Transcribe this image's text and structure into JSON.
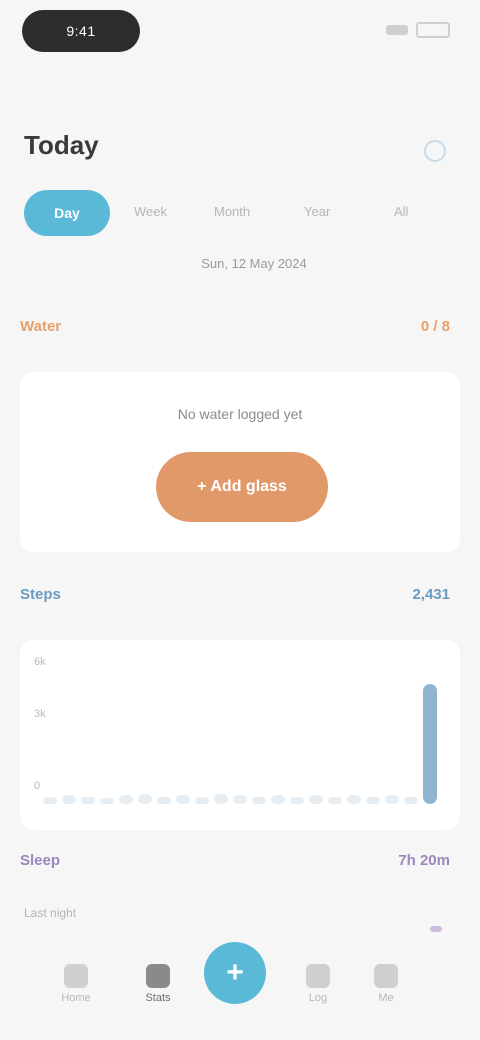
{
  "status": {
    "time": "9:41"
  },
  "header": {
    "title": "Today"
  },
  "filters": {
    "active": "Day",
    "items": [
      "Week",
      "Month",
      "Year",
      "All"
    ],
    "subtitle": "Sun, 12 May 2024"
  },
  "water": {
    "label": "Water",
    "value": "0 / 8",
    "note": "No water logged yet",
    "button_label": "+ Add glass",
    "accent": "#e2996a"
  },
  "steps": {
    "label": "Steps",
    "value": "2,431",
    "axis": [
      "6k",
      "3k",
      "0"
    ],
    "accent": "#6a9cc0",
    "bars": [
      0.05,
      0.06,
      0.05,
      0.04,
      0.06,
      0.07,
      0.05,
      0.06,
      0.05,
      0.07,
      0.06,
      0.05,
      0.06,
      0.05,
      0.06,
      0.05,
      0.06,
      0.05,
      0.06,
      0.05,
      0.8
    ]
  },
  "sleep": {
    "label": "Sleep",
    "value": "7h 20m",
    "hint": "Last night",
    "accent": "#9b86bd"
  },
  "nav": {
    "home": "Home",
    "stats": "Stats",
    "plus": "+",
    "log": "Log",
    "me": "Me"
  }
}
